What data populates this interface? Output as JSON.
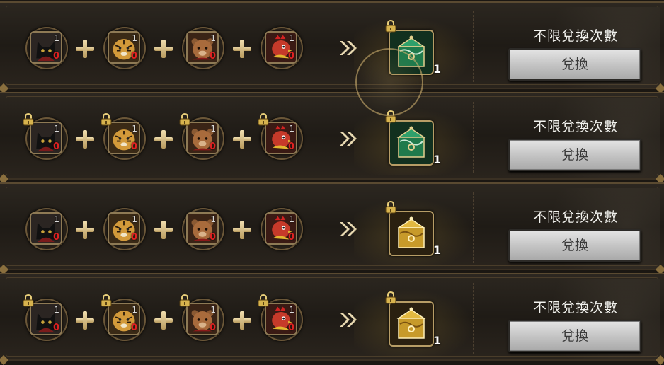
{
  "rows": [
    {
      "items": [
        {
          "type": "cat",
          "need": "1",
          "have": "0",
          "locked": false
        },
        {
          "type": "tiger",
          "need": "1",
          "have": "0",
          "locked": false
        },
        {
          "type": "bear",
          "need": "1",
          "have": "0",
          "locked": false
        },
        {
          "type": "rooster",
          "need": "1",
          "have": "0",
          "locked": false
        }
      ],
      "reward": {
        "type": "jade-chest",
        "count": "1",
        "locked": true
      },
      "limit_text": "不限兌換次數",
      "button_label": "兌換"
    },
    {
      "items": [
        {
          "type": "cat",
          "need": "1",
          "have": "0",
          "locked": true
        },
        {
          "type": "tiger",
          "need": "1",
          "have": "0",
          "locked": true
        },
        {
          "type": "bear",
          "need": "1",
          "have": "0",
          "locked": true
        },
        {
          "type": "rooster",
          "need": "1",
          "have": "0",
          "locked": true
        }
      ],
      "reward": {
        "type": "jade-chest",
        "count": "1",
        "locked": true
      },
      "limit_text": "不限兌換次數",
      "button_label": "兌換"
    },
    {
      "items": [
        {
          "type": "cat",
          "need": "1",
          "have": "0",
          "locked": false
        },
        {
          "type": "tiger",
          "need": "1",
          "have": "0",
          "locked": false
        },
        {
          "type": "bear",
          "need": "1",
          "have": "0",
          "locked": false
        },
        {
          "type": "rooster",
          "need": "1",
          "have": "0",
          "locked": false
        }
      ],
      "reward": {
        "type": "gold-chest",
        "count": "1",
        "locked": true
      },
      "limit_text": "不限兌換次數",
      "button_label": "兌換"
    },
    {
      "items": [
        {
          "type": "cat",
          "need": "1",
          "have": "0",
          "locked": true
        },
        {
          "type": "tiger",
          "need": "1",
          "have": "0",
          "locked": true
        },
        {
          "type": "bear",
          "need": "1",
          "have": "0",
          "locked": true
        },
        {
          "type": "rooster",
          "need": "1",
          "have": "0",
          "locked": true
        }
      ],
      "reward": {
        "type": "gold-chest",
        "count": "1",
        "locked": true
      },
      "limit_text": "不限兌換次數",
      "button_label": "兌換"
    }
  ],
  "colors": {
    "need_text": "#dddddd",
    "have_text": "#e02222",
    "plus_gold": "#d9c08a",
    "jade": "#1f7a4c",
    "gold_chest": "#c79a2a"
  },
  "icons": {
    "plus": "plus-icon",
    "arrow": "double-chevron-right-icon",
    "lock": "padlock-icon"
  }
}
